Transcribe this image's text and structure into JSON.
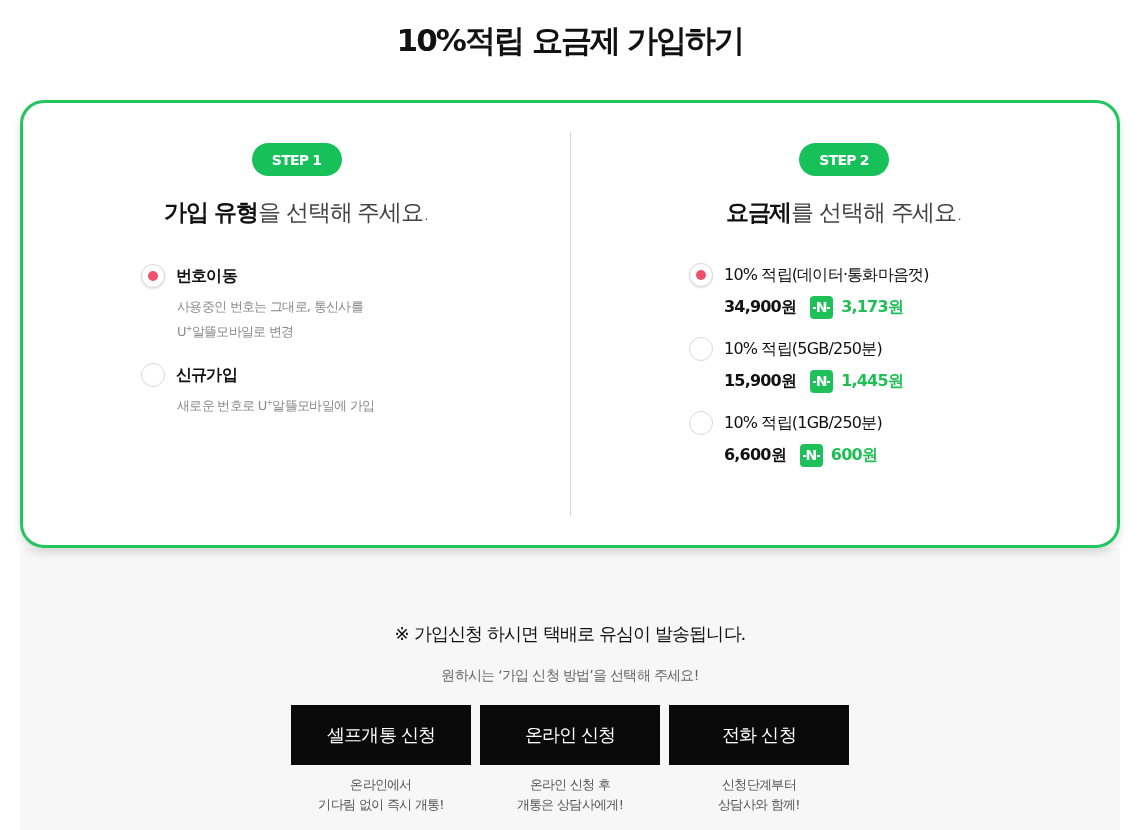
{
  "page_title": "10%적립 요금제 가입하기",
  "steps": [
    {
      "badge": "STEP 1",
      "heading": "**가입 유형**을 선택해 주세요.",
      "kind": "join_type",
      "options": [
        {
          "label": "번호이동",
          "description": [
            "사용중인 번호는 그대로, 통신사를",
            "U$^{+}$알뜰모바일로 변경"
          ],
          "selected": true
        },
        {
          "label": "신규가입",
          "description": [
            "새로운 번호로 U$^{+}$알뜰모바일에 가입"
          ],
          "selected": false
        }
      ]
    },
    {
      "badge": "STEP 2",
      "heading": "**요금제**를 선택해 주세요.",
      "kind": "plan",
      "options": [
        {
          "label": "10% 적립(데이터·통화마음껏)",
          "price": "34,900원",
          "point_mark": "N",
          "reward": "3,173원",
          "selected": true
        },
        {
          "label": "10% 적립(5GB/250분)",
          "price": "15,900원",
          "point_mark": "N",
          "reward": "1,445원",
          "selected": false
        },
        {
          "label": "10% 적립(1GB/250분)",
          "price": "6,600원",
          "point_mark": "N",
          "reward": "600원",
          "selected": false
        }
      ]
    }
  ],
  "notice": "※ 가입신청 하시면 택배로 유심이 발송됩니다.",
  "instruction": "원하시는 ‘가입 신청 방법’을 선택해 주세요!",
  "methods": [
    {
      "label": "셀프개통 신청",
      "caption": [
        "온라인에서",
        "기다림 없이 즉시 개통!"
      ]
    },
    {
      "label": "온라인 신청",
      "caption": [
        "온라인 신청 후",
        "개통은 상담사에게!"
      ]
    },
    {
      "label": "전화 신청",
      "caption": [
        "신청단계부터",
        "상담사와 함께!"
      ]
    }
  ]
}
